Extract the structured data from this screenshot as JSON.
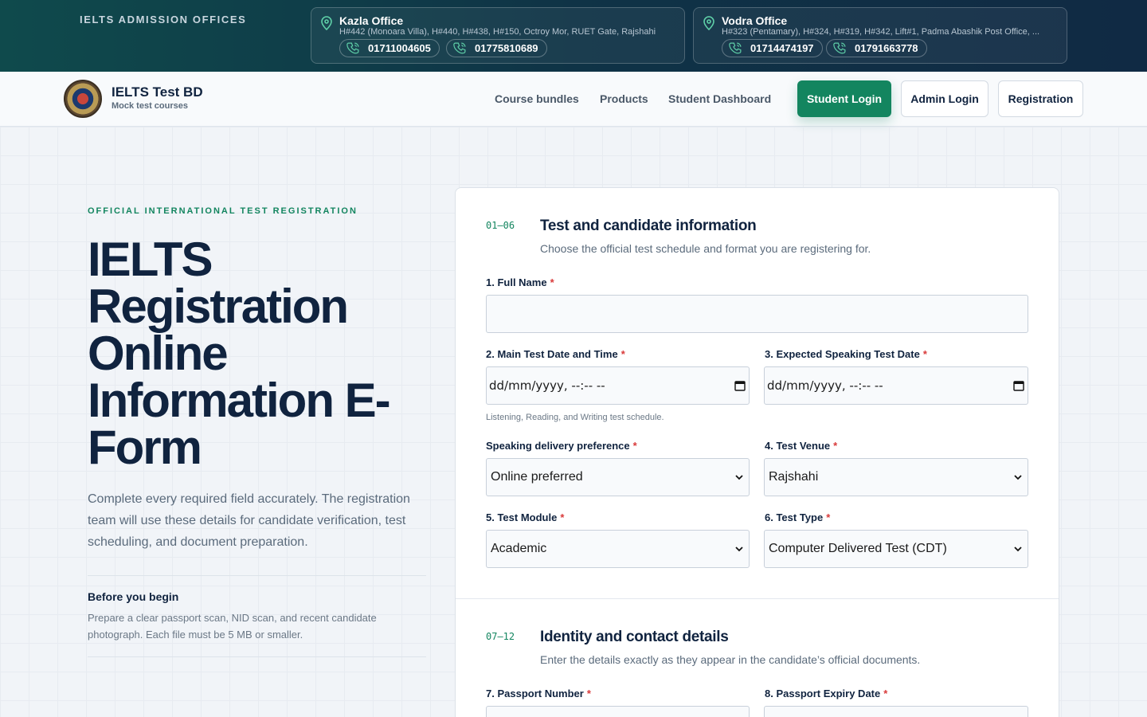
{
  "topbar": {
    "brand_label": "IELTS ADMISSION OFFICES",
    "offices": [
      {
        "name": "Kazla Office",
        "address": "H#442 (Monoara Villa), H#440, H#438, H#150, Octroy Mor, RUET Gate, Rajshahi",
        "phones": [
          "01711004605",
          "01775810689"
        ]
      },
      {
        "name": "Vodra Office",
        "address": "H#323 (Pentamary), H#324, H#319, H#342, Lift#1, Padma Abashik Post Office, ...",
        "phones": [
          "01714474197",
          "01791663778"
        ]
      }
    ]
  },
  "nav": {
    "site_title": "IELTS Test BD",
    "site_subtitle": "Mock test courses",
    "links": [
      "Course bundles",
      "Products",
      "Student Dashboard"
    ],
    "student_login": "Student Login",
    "admin_login": "Admin Login",
    "registration": "Registration"
  },
  "hero": {
    "eyebrow": "OFFICIAL INTERNATIONAL TEST REGISTRATION",
    "title": "IELTS Registration Online Information E-Form",
    "lead": "Complete every required field accurately. The registration team will use these details for candidate verification, test scheduling, and document preparation.",
    "before_title": "Before you begin",
    "before_text": "Prepare a clear passport scan, NID scan, and recent candidate photograph. Each file must be 5 MB or smaller."
  },
  "form": {
    "section1": {
      "number": "01–06",
      "title": "Test and candidate information",
      "description": "Choose the official test schedule and format you are registering for."
    },
    "full_name_label": "1. Full Name",
    "full_name_value": "",
    "main_date_label": "2. Main Test Date and Time",
    "main_date_value": "dd/mm/yyyy, --:-- --",
    "main_date_hint": "Listening, Reading, and Writing test schedule.",
    "speaking_date_label": "3. Expected Speaking Test Date",
    "speaking_date_value": "dd/mm/yyyy, --:-- --",
    "speaking_pref_label": "Speaking delivery preference",
    "speaking_pref_value": "Online preferred",
    "venue_label": "4. Test Venue",
    "venue_value": "Rajshahi",
    "module_label": "5. Test Module",
    "module_value": "Academic",
    "type_label": "6. Test Type",
    "type_value": "Computer Delivered Test (CDT)",
    "required_mark": "*",
    "section2": {
      "number": "07–12",
      "title": "Identity and contact details",
      "description": "Enter the details exactly as they appear in the candidate’s official documents."
    },
    "passport_label": "7. Passport Number",
    "passport_expiry_label": "8. Passport Expiry Date"
  },
  "colors": {
    "accent": "#13855f",
    "navy": "#10233f",
    "topbar": "#0f3346"
  }
}
